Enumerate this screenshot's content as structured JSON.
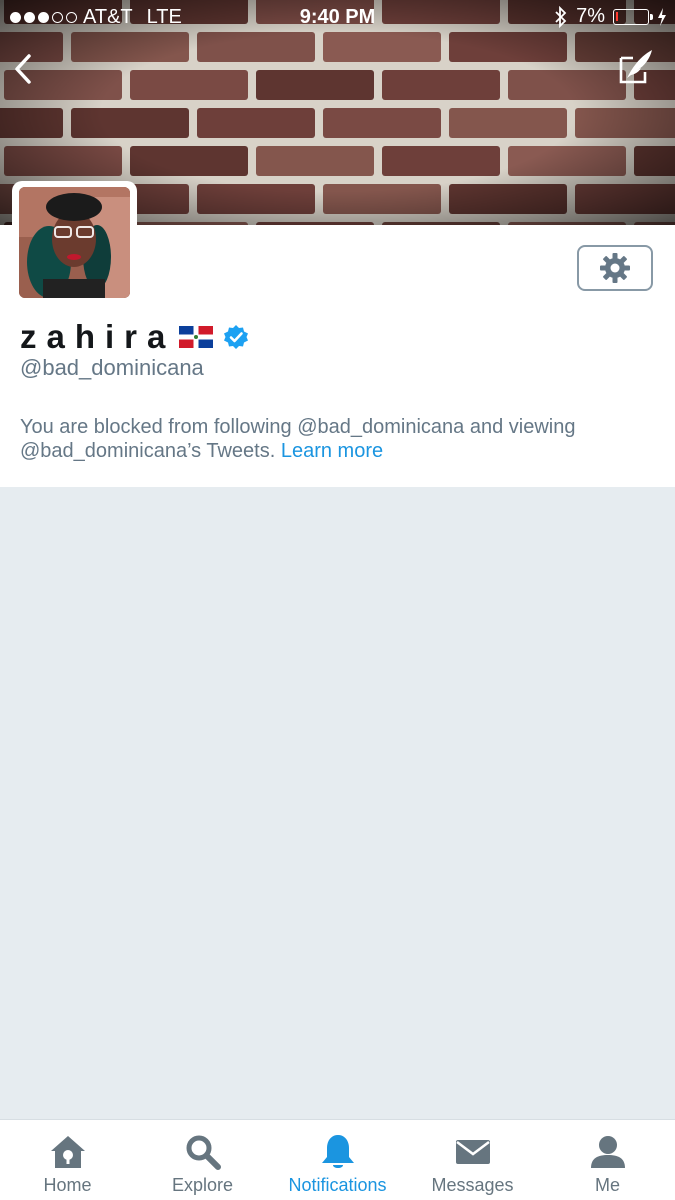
{
  "status_bar": {
    "carrier": "AT&T",
    "network": "LTE",
    "time": "9:40 PM",
    "battery_percent": "7%",
    "battery_level": 0.07,
    "signal_bars": 3
  },
  "header": {
    "back_icon": "chevron-left-icon",
    "compose_icon": "compose-tweet-icon"
  },
  "profile": {
    "name": "zahira",
    "flag_icon": "dominican-flag-icon",
    "verified": true,
    "handle": "@bad_dominicana",
    "blocked_message": "You are blocked from following @bad_dominicana and viewing @bad_dominicana’s Tweets.",
    "learn_more": "Learn more",
    "settings_icon": "gear-icon"
  },
  "tabs": [
    {
      "label": "Home",
      "icon": "home-icon",
      "active": false
    },
    {
      "label": "Explore",
      "icon": "search-icon",
      "active": false
    },
    {
      "label": "Notifications",
      "icon": "bell-icon",
      "active": true
    },
    {
      "label": "Messages",
      "icon": "envelope-icon",
      "active": false
    },
    {
      "label": "Me",
      "icon": "person-icon",
      "active": false
    }
  ],
  "colors": {
    "accent": "#1b95e0",
    "muted_text": "#657786",
    "background": "#e6ecf0",
    "battery_low": "#ff3b30"
  }
}
